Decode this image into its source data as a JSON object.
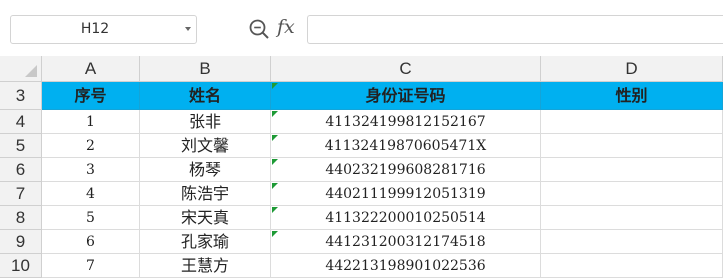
{
  "name_box": {
    "value": "H12"
  },
  "formula_bar": {
    "fx_label": "fx",
    "value": ""
  },
  "columns": [
    "A",
    "B",
    "C",
    "D"
  ],
  "header_row": {
    "number": "3",
    "cells": [
      "序号",
      "姓名",
      "身份证号码",
      "性别"
    ]
  },
  "rows": [
    {
      "number": "4",
      "cells": [
        "1",
        "张非",
        "411324199812152167",
        ""
      ]
    },
    {
      "number": "5",
      "cells": [
        "2",
        "刘文馨",
        "41132419870605471X",
        ""
      ]
    },
    {
      "number": "6",
      "cells": [
        "3",
        "杨琴",
        "440232199608281716",
        ""
      ]
    },
    {
      "number": "7",
      "cells": [
        "4",
        "陈浩宇",
        "440211199912051319",
        ""
      ]
    },
    {
      "number": "8",
      "cells": [
        "5",
        "宋天真",
        "411322200010250514",
        ""
      ]
    },
    {
      "number": "9",
      "cells": [
        "6",
        "孔家瑜",
        "441231200312174518",
        ""
      ]
    },
    {
      "number": "10",
      "cells": [
        "7",
        "王慧方",
        "442213198901022536",
        ""
      ]
    }
  ],
  "colors": {
    "header_fill": "#00b0f0",
    "text_marker": "#1e9a36",
    "header_bg": "#f2f2f2"
  },
  "icons": {
    "zoom": "zoom-formula-icon",
    "fx": "fx-icon",
    "dropdown": "chevron-down-icon"
  }
}
